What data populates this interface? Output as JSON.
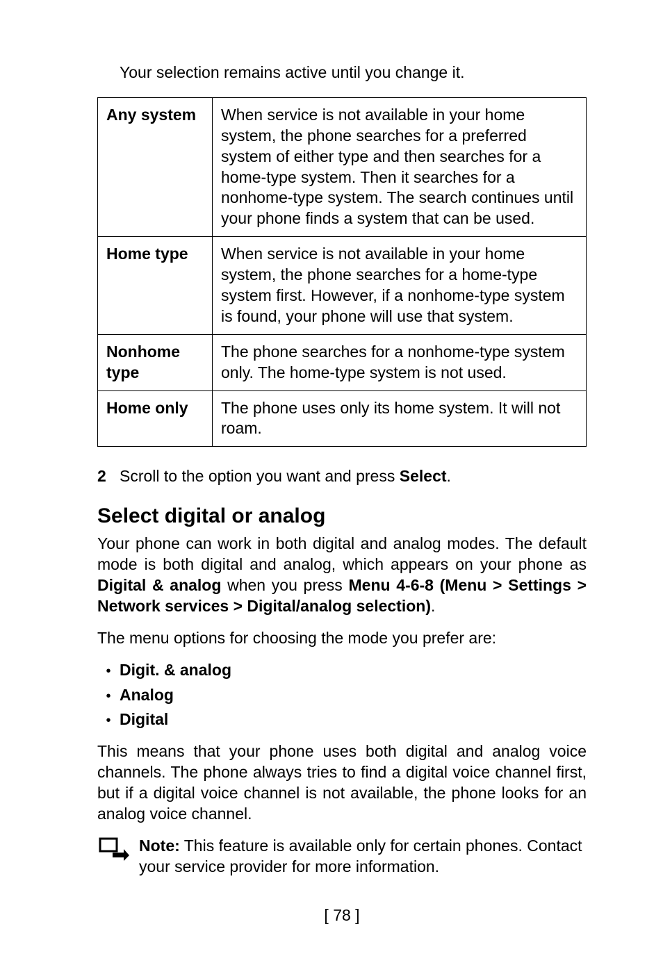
{
  "intro": "Your selection remains active until you change it.",
  "table": [
    {
      "label": "Any system",
      "desc": "When service is not available in your home system, the phone searches for a preferred system of either type and then searches for a home-type system. Then it searches for a nonhome-type system. The search continues until your phone finds a system that can be used."
    },
    {
      "label": "Home type",
      "desc": "When service is not available in your home system, the phone searches for a home-type system first. However, if a nonhome-type system is found, your phone will use that system."
    },
    {
      "label": "Nonhome type",
      "desc": "The phone searches for a nonhome-type system only. The home-type system is not used."
    },
    {
      "label": "Home only",
      "desc": "The phone uses only its home system. It will not roam."
    }
  ],
  "step": {
    "num": "2",
    "before": "Scroll to the option you want and press ",
    "bold": "Select",
    "after": "."
  },
  "section_heading": "Select digital or analog",
  "para1": {
    "a": "Your phone can work in both digital and analog modes. The default mode is both digital and analog, which appears on your phone as ",
    "b": "Digital & analog",
    "c": " when you press ",
    "d": "Menu 4-6-8 (Menu > Settings > Network services > Digital/analog selection)",
    "e": "."
  },
  "para2": "The menu options for choosing the mode you prefer are:",
  "modes": [
    "Digit. & analog",
    "Analog",
    "Digital"
  ],
  "para3": "This means that your phone uses both digital and analog voice channels. The phone always tries to find a digital voice channel first, but if a digital voice channel is not available, the phone looks for an analog voice channel.",
  "note": {
    "label": "Note:",
    "text": " This feature is available only for certain phones. Contact your service provider for more information."
  },
  "page_number": "[ 78 ]"
}
